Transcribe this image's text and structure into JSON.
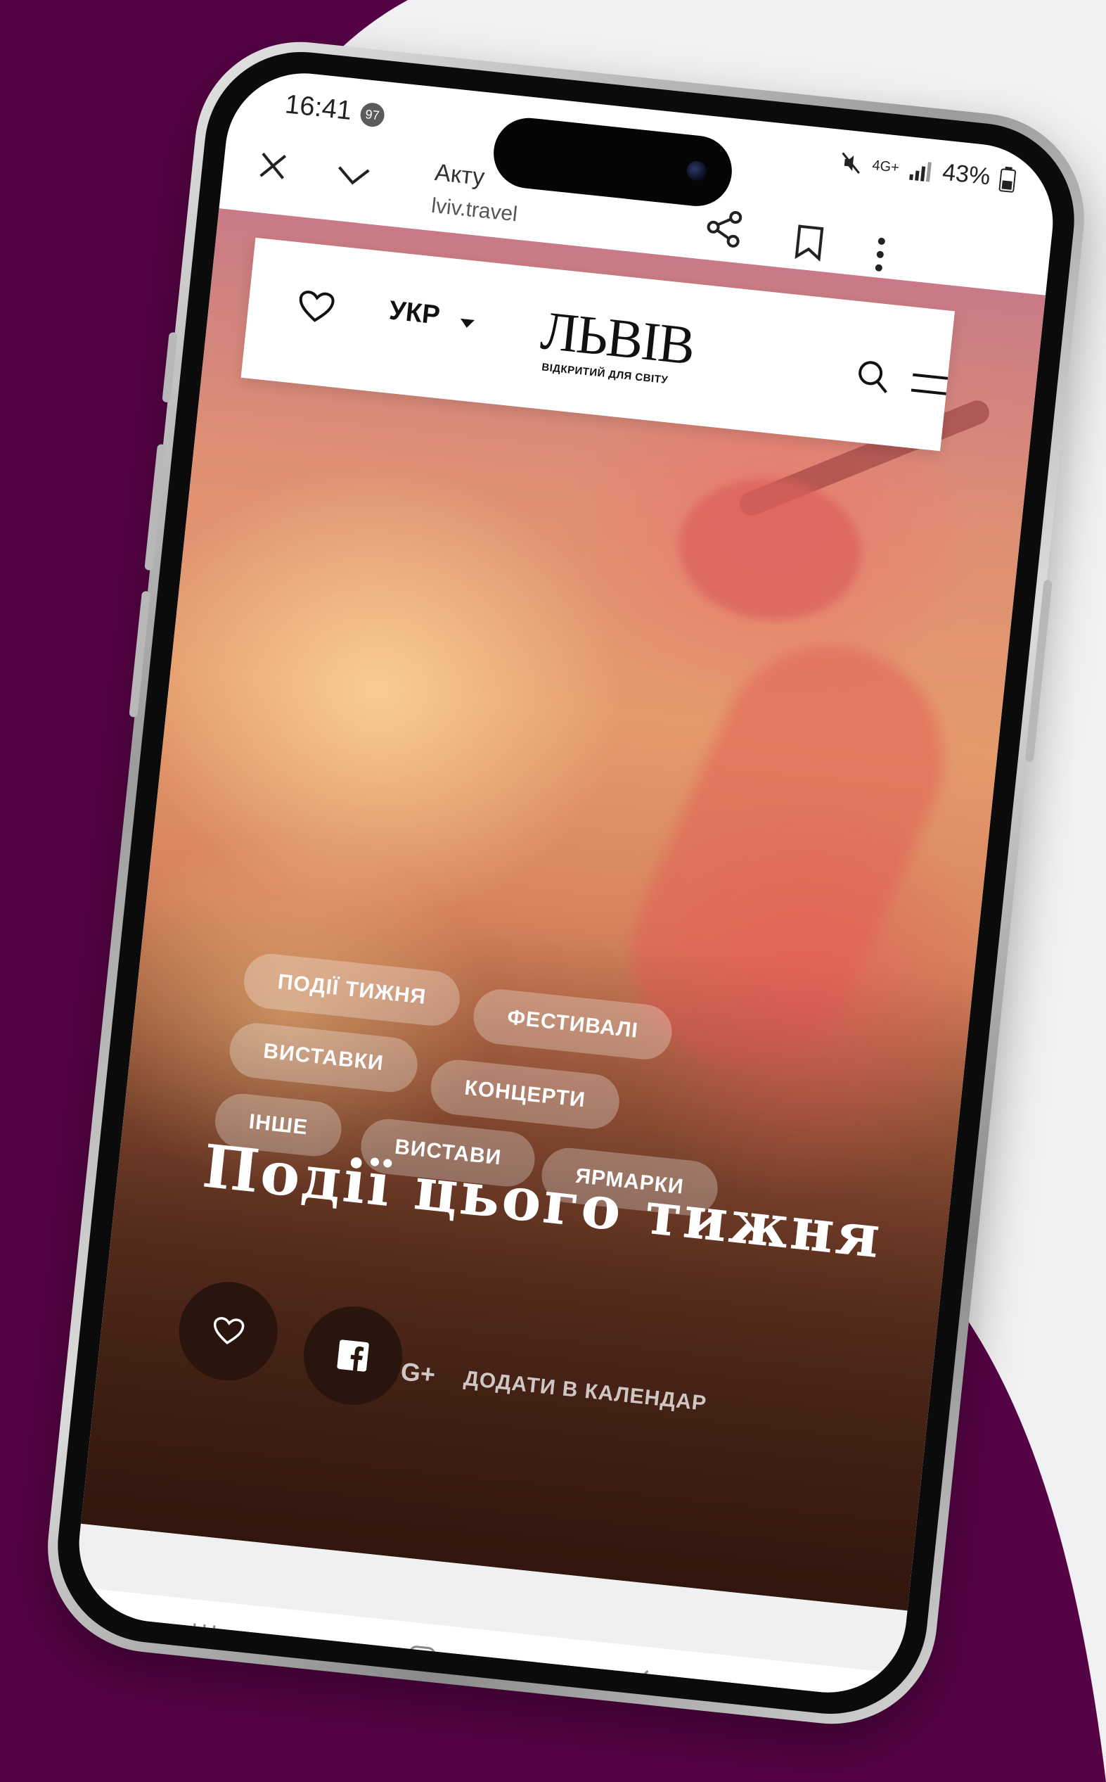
{
  "status_bar": {
    "time": "16:41",
    "notification_count": "97",
    "network": "4G+",
    "battery": "43%"
  },
  "browser": {
    "title": "Акту",
    "url": "lviv.travel",
    "icons": [
      "close-icon",
      "chevron-down-icon",
      "share-icon",
      "bookmark-icon",
      "more-vert-icon"
    ]
  },
  "site_header": {
    "language": "УКР",
    "logo_title": "ЛЬВІВ",
    "logo_subtitle": "ВІДКРИТИЙ ДЛЯ СВІТУ",
    "icons": [
      "heart-icon",
      "caret-down-icon",
      "search-icon",
      "menu-icon"
    ]
  },
  "tags": [
    "ПОДІЇ ТИЖНЯ",
    "ФЕСТИВАЛІ",
    "ВИСТАВКИ",
    "КОНЦЕРТИ",
    "ІНШЕ",
    "ВИСТАВИ",
    "ЯРМАРКИ"
  ],
  "hero": {
    "title": "Події цього тижня",
    "gplus_label": "G+",
    "calendar_label": "ДОДАТИ В КАЛЕНДАР",
    "icons": [
      "heart-icon",
      "facebook-icon"
    ]
  },
  "nav_bar": {
    "icons": [
      "recent-apps-icon",
      "home-icon",
      "back-icon"
    ]
  },
  "colors": {
    "background_shape": "#560345",
    "page_background": "#f1f0f2",
    "tag_fill": "rgba(255,255,255,0.28)",
    "circle_button": "#2a150e"
  }
}
